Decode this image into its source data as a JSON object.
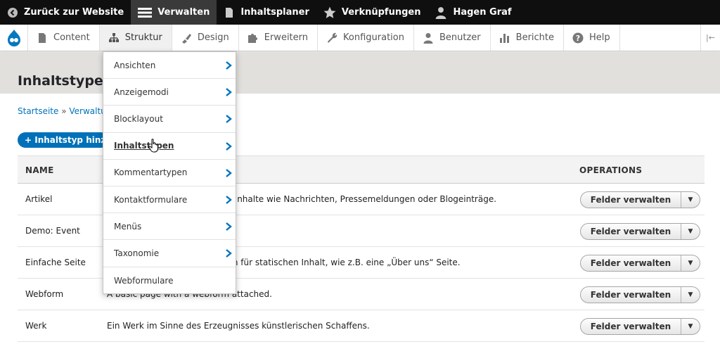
{
  "toolbar": {
    "back_label": "Zurück zur Website",
    "manage_label": "Verwalten",
    "planner_label": "Inhaltsplaner",
    "shortcuts_label": "Verknüpfungen",
    "user_label": "Hagen Graf"
  },
  "tray": {
    "items": [
      {
        "label": "Content",
        "icon": "document-icon"
      },
      {
        "label": "Struktur",
        "icon": "hierarchy-icon"
      },
      {
        "label": "Design",
        "icon": "paintbrush-icon"
      },
      {
        "label": "Erweitern",
        "icon": "puzzle-icon"
      },
      {
        "label": "Konfiguration",
        "icon": "wrench-icon"
      },
      {
        "label": "Benutzer",
        "icon": "person-icon"
      },
      {
        "label": "Berichte",
        "icon": "bar-chart-icon"
      },
      {
        "label": "Help",
        "icon": "help-icon"
      }
    ],
    "collapse_glyph": "|←"
  },
  "page": {
    "title": "Inhaltstypen",
    "breadcrumb_home": "Startseite",
    "breadcrumb_sep": "»",
    "breadcrumb_current": "Verwaltung",
    "add_button": "+ Inhaltstyp hinzufügen"
  },
  "table": {
    "col_name": "NAME",
    "col_ops": "OPERATIONS",
    "op_label": "Felder verwalten",
    "op_toggle": "▼",
    "rows": [
      {
        "name": "Artikel",
        "desc": "Für zeitsensitive, dynamische Inhalte wie Nachrichten, Pressemeldungen oder Blogeinträge."
      },
      {
        "name": "Demo: Event",
        "desc": ""
      },
      {
        "name": "Einfache Seite",
        "desc": "Verwenden Sie Einfache Seiten für statischen Inhalt, wie z.B. eine „Über uns“ Seite."
      },
      {
        "name": "Webform",
        "desc": "A basic page with a webform attached."
      },
      {
        "name": "Werk",
        "desc": "Ein Werk im Sinne des Erzeugnisses künstlerischen Schaffens."
      }
    ]
  },
  "menu": {
    "items": [
      {
        "label": "Ansichten",
        "has_sub": true
      },
      {
        "label": "Anzeigemodi",
        "has_sub": true
      },
      {
        "label": "Blocklayout",
        "has_sub": true
      },
      {
        "label": "Inhaltstypen",
        "has_sub": true
      },
      {
        "label": "Kommentartypen",
        "has_sub": true
      },
      {
        "label": "Kontaktformulare",
        "has_sub": true
      },
      {
        "label": "Menüs",
        "has_sub": true
      },
      {
        "label": "Taxonomie",
        "has_sub": true
      },
      {
        "label": "Webformulare",
        "has_sub": false
      }
    ]
  },
  "colors": {
    "toolbar_bg": "#0f0f0f",
    "accent": "#0071b8",
    "link": "#0074bd",
    "header_band": "#e1e0dd"
  }
}
